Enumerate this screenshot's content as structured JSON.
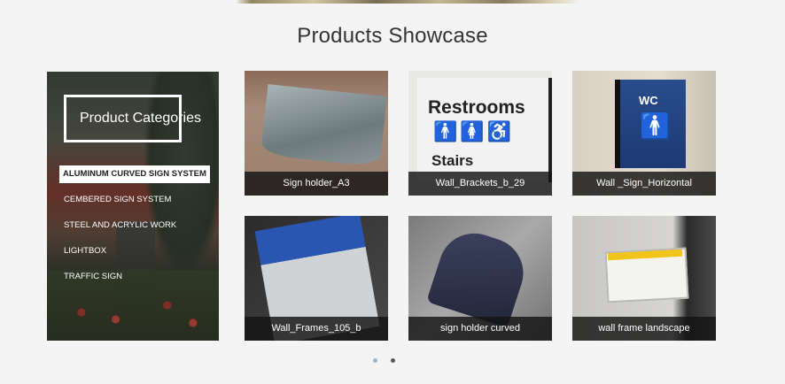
{
  "page": {
    "title": "Products Showcase"
  },
  "sidebar": {
    "heading": "Product Categories",
    "items": [
      {
        "label": "ALUMINUM CURVED SIGN SYSTEM",
        "active": true
      },
      {
        "label": "CEMBERED SIGN SYSTEM",
        "active": false
      },
      {
        "label": "STEEL AND ACRYLIC WORK",
        "active": false
      },
      {
        "label": "LIGHTBOX",
        "active": false
      },
      {
        "label": "TRAFFIC SIGN",
        "active": false
      }
    ]
  },
  "products": [
    {
      "caption": "Sign holder_A3"
    },
    {
      "caption": "Wall_Brackets_b_29",
      "image_text": [
        "Restrooms",
        "Stairs"
      ]
    },
    {
      "caption": "Wall _Sign_Horizontal",
      "image_text": [
        "WC"
      ]
    },
    {
      "caption": "Wall_Frames_105_b"
    },
    {
      "caption": "sign holder curved"
    },
    {
      "caption": "wall frame landscape"
    }
  ],
  "pager": {
    "pages": 2,
    "active": 1,
    "colors": {
      "active": "#9bb6cf",
      "inactive": "#555555"
    }
  }
}
